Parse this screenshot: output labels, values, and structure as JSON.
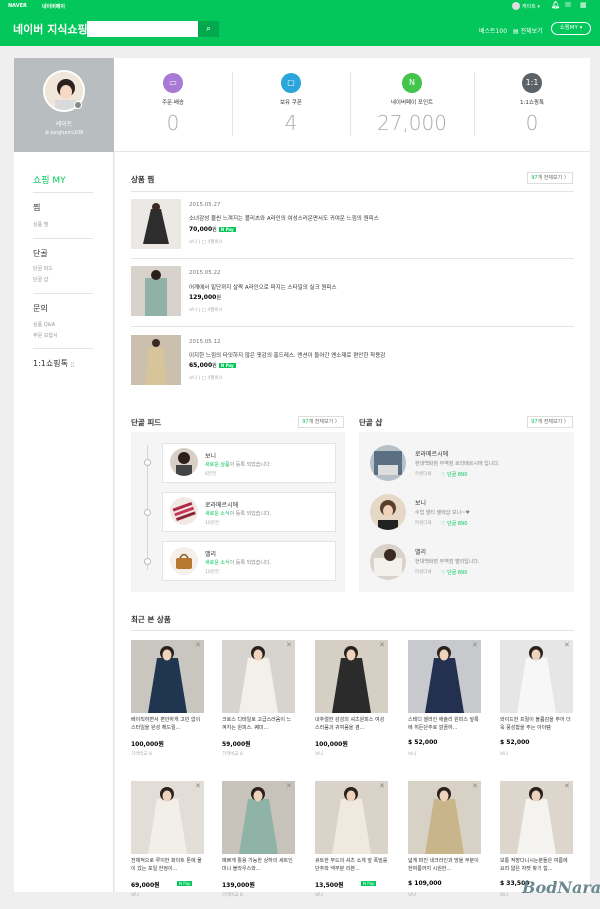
{
  "topbar": {
    "naver": "NAVER",
    "service": "네이버페이",
    "user": "캐이트 ▾"
  },
  "header": {
    "brand": "네이버 지식쇼핑",
    "best": "베스트100",
    "all": "▤ 전체보기",
    "my": "쇼핑MY ▾"
  },
  "profile": {
    "name": "케이트",
    "id": "junglunrs208"
  },
  "stats": [
    {
      "label": "주문·배송",
      "value": "0",
      "color": "#a97ad5",
      "icon": "delivery-icon"
    },
    {
      "label": "보유 쿠폰",
      "value": "4",
      "color": "#2aa6da",
      "icon": "coupon-icon"
    },
    {
      "label": "네이버페이 포인트",
      "value": "27,000",
      "color": "#43c54c",
      "icon": "point-icon"
    },
    {
      "label": "1:1쇼핑톡",
      "value": "0",
      "color": "#5b6268",
      "icon": "talk-icon"
    }
  ],
  "sidebar": {
    "title": "쇼핑 MY",
    "groups": [
      {
        "title": "찜",
        "items": [
          "상품 찜"
        ]
      },
      {
        "title": "단골",
        "items": [
          "단골 피드",
          "단골 샵"
        ]
      },
      {
        "title": "문의",
        "items": [
          "상품 Q&A",
          "주문 모험서"
        ]
      }
    ],
    "talk": "1:1쇼핑톡"
  },
  "wish": {
    "title": "상품 찜",
    "more_count": "97",
    "more_text": "개 전체보기 〉",
    "items": [
      {
        "date": "2015.05.27",
        "title": "소녀감성 물씬 느껴지는 플리츠와 A라인의 여성스러운면서도 귀여운 느낌의 원피스",
        "price": "70,000",
        "unit": "원",
        "pay": "N Pay",
        "meta": "보니  |  □ 4월위시"
      },
      {
        "date": "2015.05.22",
        "title": "어깨에서 밑단까지 살짝 A라인으로 퍼지는 스타일의 실크 원피스",
        "price": "129,000",
        "unit": "원",
        "meta": "보니  |  □ 4월위시"
      },
      {
        "date": "2015.05.12",
        "title": "이지한 느낌의 타잇하지 않은 핏감의 홍드레스. 엔션이 들어간 옌소재로 편안한 착용감",
        "price": "65,000",
        "unit": "원",
        "pay": "N Pay",
        "meta": "보니  |  □ 4월위시"
      }
    ]
  },
  "feed": {
    "title": "단골 피드",
    "more_count": "97",
    "more_text": "개 전체보기 〉",
    "items": [
      {
        "name": "보니",
        "pre": "새로운 상품",
        "post": "이 등록 되었습니다.",
        "time": "6분전"
      },
      {
        "name": "로라메르시에",
        "pre": "새로운 소식",
        "post": "이 등록 되었습니다.",
        "time": "10분전"
      },
      {
        "name": "밸리",
        "pre": "새로운 소식",
        "post": "이 등록 되었습니다.",
        "time": "10분전"
      }
    ]
  },
  "shops": {
    "title": "단골 샵",
    "more_count": "97",
    "more_text": "개 전체보기 〉",
    "items": [
      {
        "name": "로라메르시에",
        "desc": "현대백화점 무역점 로라메르시에 입니다.",
        "tag": "파센더쇄",
        "fans": "♡ 단골 890"
      },
      {
        "name": "보니",
        "desc": "수업 열티 셀렉샵 보니~♥",
        "tag": "파센더쇄",
        "fans": "♡ 단골 890"
      },
      {
        "name": "밸리",
        "desc": "현대백화점 무역점 밸리입니다.",
        "tag": "파센더쇄",
        "fans": "♡ 단골 890"
      }
    ]
  },
  "recent": {
    "title": "최근 본 상품",
    "rows": [
      [
        {
          "title": "베이직하면서 편안하게 고민 없이 스타일을 완성 해드릴...",
          "price": "100,000원",
          "meta": "가격비교 8"
        },
        {
          "title": "크로스 디테일로 고급스러움이 느껴지는 원피스. 퀘미...",
          "price": "59,000원",
          "meta": "가격비교 8"
        },
        {
          "title": "내추럴한 감성의 셔츠원피스 여성스러움과 귀여움을 겸...",
          "price": "100,000원",
          "meta": "보니"
        },
        {
          "title": "스테디 셀러인 애슐리 원피스 앞록에 히든단추로 깔끔하...",
          "price": "$ 52,000",
          "meta": "보니"
        },
        {
          "title": "와이드한 프릴이 볼륨감을 주어 더욱 풍성함을 주는 아이템",
          "price": "$ 52,000",
          "meta": "보니"
        }
      ],
      [
        {
          "title": "전체적으로 루이한 화이트 톤에 물이 갔는 포일 한정이...",
          "price": "69,000원",
          "pay": "N Pay",
          "meta": "보니"
        },
        {
          "title": "예쁘게 활용 가능한 상하의 세트인 미니 블라우스와...",
          "price": "139,000원",
          "meta": "가격비교 8"
        },
        {
          "title": "큐트한 무드의 셔츠 소게 앞 폭밀룰 단추와 넥부분 리본...",
          "price": "13,500원",
          "pay": "N Pay",
          "meta": "보니"
        },
        {
          "title": "넓게 퍼진 네크라인과 망울 부분이 한여름까지 시원한...",
          "price": "$ 109,000",
          "meta": "보니"
        },
        {
          "title": "보통 적장다니시는분들은 여름에 요리 얇은 자켓 찾기 힘...",
          "price": "$ 33,500",
          "meta": "보니"
        }
      ]
    ]
  },
  "watermark": "BodNara"
}
